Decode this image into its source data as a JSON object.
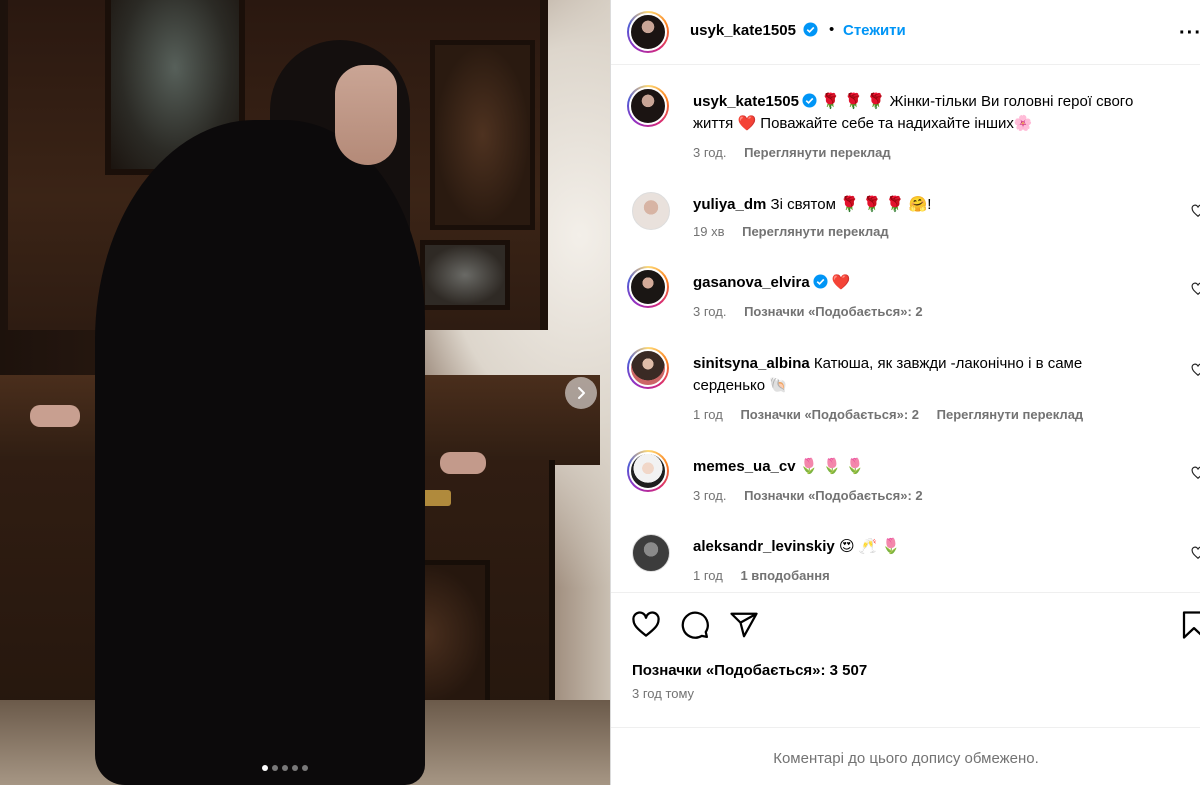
{
  "post": {
    "author": "usyk_kate1505",
    "follow_label": "Стежити",
    "separator": "•",
    "more_label": "···",
    "caption": {
      "emojis": "🌹 🌹 🌹",
      "text": "Жінки-тільки Ви головні герої свого життя ❤️ Поважайте себе та надихайте інших🌸",
      "time": "3 год.",
      "translate": "Переглянути переклад"
    },
    "photo": {
      "carousel_count": 5,
      "current_index": 0
    }
  },
  "comments": [
    {
      "user": "yuliya_dm",
      "verified": false,
      "text": "Зі святом 🌹 🌹 🌹 🤗!",
      "time": "19 хв",
      "likes": "",
      "translate": "Переглянути переклад"
    },
    {
      "user": "gasanova_elvira",
      "verified": true,
      "text": "❤️",
      "time": "3 год.",
      "likes": "Позначки «Подобається»: 2",
      "translate": ""
    },
    {
      "user": "sinitsyna_albina",
      "verified": false,
      "text": "Катюша, як завжди -лаконічно і в саме серденько 🐚",
      "time": "1 год",
      "likes": "Позначки «Подобається»: 2",
      "translate": "Переглянути переклад"
    },
    {
      "user": "memes_ua_cv",
      "verified": false,
      "text": "🌷 🌷 🌷",
      "time": "3 год.",
      "likes": "Позначки «Подобається»: 2",
      "translate": ""
    },
    {
      "user": "aleksandr_levinskiy",
      "verified": false,
      "text": "😍 🥂 🌷",
      "time": "1 год",
      "likes": "1 вподобання",
      "translate": ""
    }
  ],
  "footer": {
    "likes_count": "Позначки «Подобається»: 3 507",
    "posted_ago": "3 год тому",
    "comments_limited": "Коментарі до цього допису обмежено."
  },
  "colors": {
    "accent": "#0095f6",
    "verified": "#0095f6",
    "muted": "#737373",
    "divider": "#efefef"
  }
}
